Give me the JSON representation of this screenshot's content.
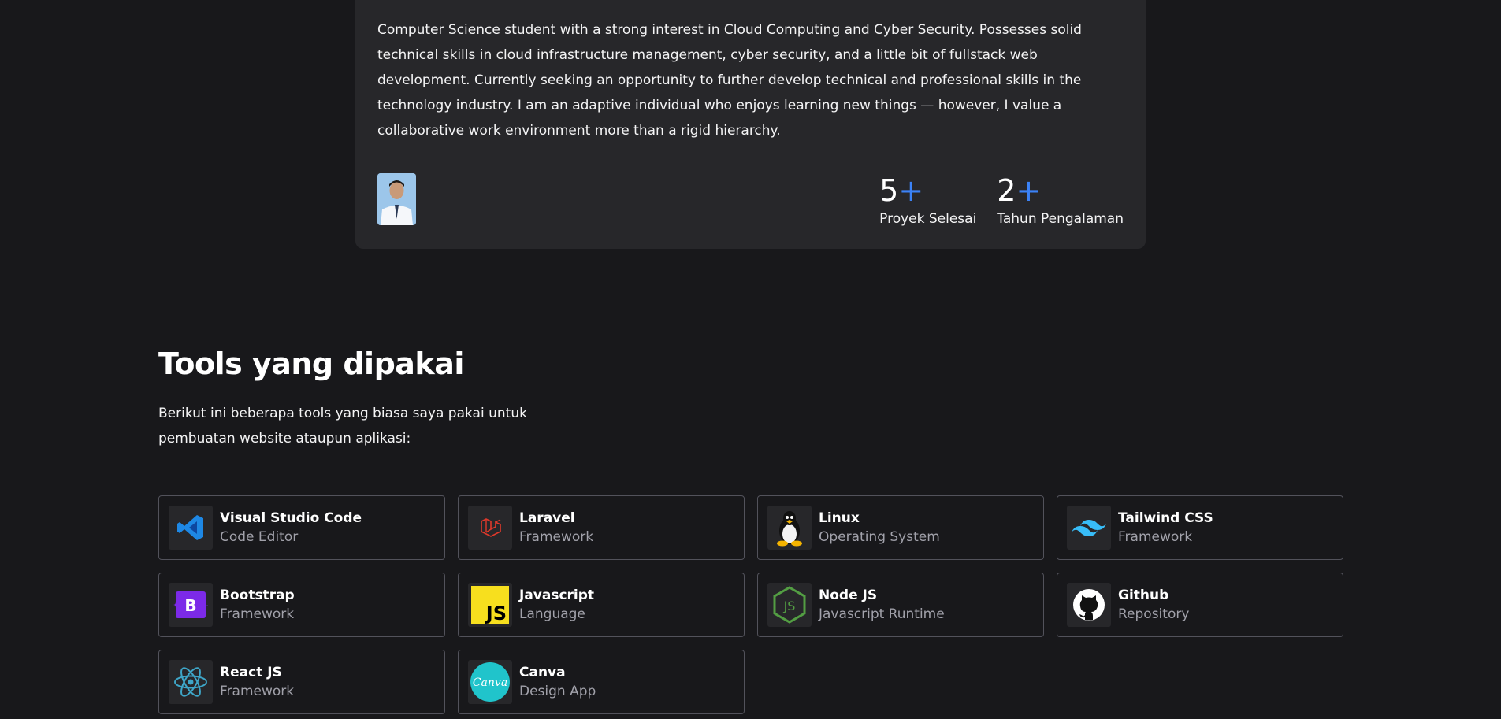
{
  "about": {
    "bio": "Computer Science student with a strong interest in Cloud Computing and Cyber Security. Possesses solid technical skills in cloud infrastructure management, cyber security, and a little bit of fullstack web development. Currently seeking an opportunity to further develop technical and professional skills in the technology industry. I am an adaptive individual who enjoys learning new things — however, I value a collaborative work environment more than a rigid hierarchy.",
    "stats": [
      {
        "value": "5",
        "plus": "+",
        "label": "Proyek Selesai"
      },
      {
        "value": "2",
        "plus": "+",
        "label": "Tahun Pengalaman"
      }
    ]
  },
  "tools": {
    "title": "Tools yang dipakai",
    "description": "Berikut ini beberapa tools yang biasa saya pakai untuk pembuatan website ataupun aplikasi:",
    "items": [
      {
        "name": "Visual Studio Code",
        "type": "Code Editor",
        "icon": "vscode-icon"
      },
      {
        "name": "Laravel",
        "type": "Framework",
        "icon": "laravel-icon"
      },
      {
        "name": "Linux",
        "type": "Operating System",
        "icon": "linux-icon"
      },
      {
        "name": "Tailwind CSS",
        "type": "Framework",
        "icon": "tailwind-icon"
      },
      {
        "name": "Bootstrap",
        "type": "Framework",
        "icon": "bootstrap-icon"
      },
      {
        "name": "Javascript",
        "type": "Language",
        "icon": "javascript-icon"
      },
      {
        "name": "Node JS",
        "type": "Javascript Runtime",
        "icon": "nodejs-icon"
      },
      {
        "name": "Github",
        "type": "Repository",
        "icon": "github-icon"
      },
      {
        "name": "React JS",
        "type": "Framework",
        "icon": "react-icon"
      },
      {
        "name": "Canva",
        "type": "Design App",
        "icon": "canva-icon"
      }
    ]
  },
  "colors": {
    "background": "#18181b",
    "card": "#27272a",
    "accent": "#3b82f6",
    "muted_text": "#a1a1aa"
  }
}
